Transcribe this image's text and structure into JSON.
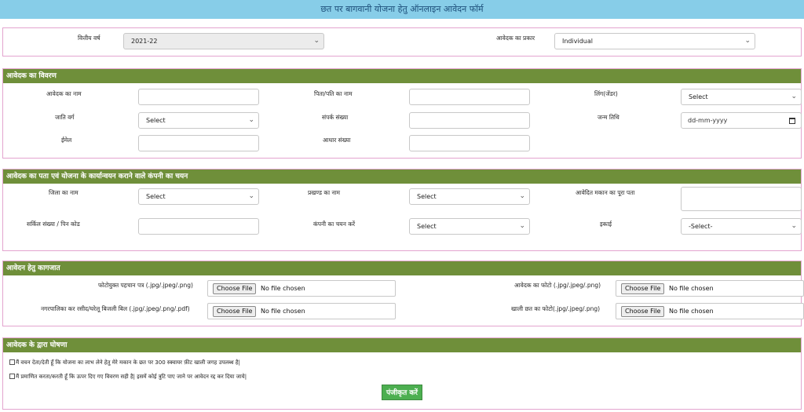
{
  "header": {
    "title": "छत पर बागवानी योजना हेतु ऑनलाइन आवेदन फॉर्म"
  },
  "top": {
    "fy_label": "वित्तीय वर्ष",
    "fy_value": "2021-22",
    "applicant_type_label": "आवेदक का प्रकार",
    "applicant_type_value": "Individual"
  },
  "applicant": {
    "heading": "आवेदक का विवरण",
    "name_label": "आवेदक का नाम",
    "father_label": "पिता/पति का नाम",
    "gender_label": "लिंग(जेंडर)",
    "gender_value": "Select",
    "caste_label": "जाति वर्ग",
    "caste_value": "Select",
    "contact_label": "संपर्क संख्या",
    "dob_label": "जन्म तिथि",
    "dob_value": "dd-mm-yyyy",
    "email_label": "ईमेल",
    "aadhaar_label": "आधार संख्या"
  },
  "address": {
    "heading": "आवेदक का पता एवं योजना के कार्यान्वयन कराने वाले कंपनी का चयन",
    "district_label": "जिला का नाम",
    "district_value": "Select",
    "block_label": "प्रखण्ड का नाम",
    "block_value": "Select",
    "house_label": "आवेदित मकान का पूरा पता",
    "circle_label": "सर्किल संख्या / पिन कोड",
    "company_label": "कंपनी का चयन करें",
    "company_value": "Select",
    "unit_label": "इकाई",
    "unit_value": "-Select-"
  },
  "documents": {
    "heading": "आवेदन हेतु कागजात",
    "photo_id_label": "फोटोयुक्त पहचान पत्र (.jpg/.jpeg/.png)",
    "photo_label": "आवेदक का फोटो (.jpg/.jpeg/.png)",
    "bill_label": "नगरपालिका कर रसीद/घरेलू बिजली बिल (.jpg/.jpeg/.png/.pdf)",
    "roof_label": "खाली छत का फोटो(.jpg/.jpeg/.png)",
    "choose_file": "Choose File",
    "no_file": "No file chosen"
  },
  "declaration": {
    "heading": "आवेदक के द्वारा घोषणा",
    "line1": "मैं वचन देता/देती हूँ कि योजना का लाभ लेने हेतु मेरे मकान के छत पर 300 स्क्वायर फ़ीट खाली जगह उपलब्ध है|",
    "line2": "मैं प्रमाणित करता/करती हूँ कि ऊपर दिए गए विवरण सही है| इसमें कोई त्रुटि पाए जाने पर आवेदन रद्द कर दिया जाये|",
    "submit": "पंजीकृत करें"
  }
}
